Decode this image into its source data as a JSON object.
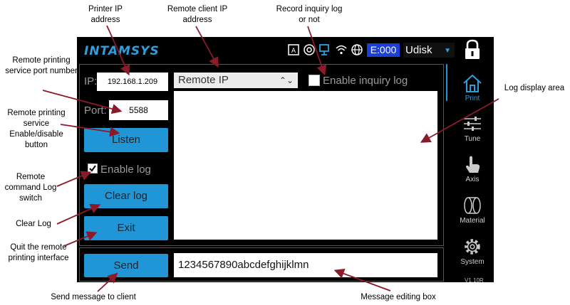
{
  "screen": {
    "logo": "INTAMSYS",
    "error_code": "E:000",
    "storage": "Udisk",
    "ip_label": "IP:",
    "ip_value": "192.168.1.209",
    "port_label": "Port:",
    "port_value": "5588",
    "listen_label": "Listen",
    "enable_log_label": "Enable log",
    "enable_log_checked": true,
    "clear_log_label": "Clear log",
    "exit_label": "Exit",
    "send_label": "Send",
    "remote_ip_select": "Remote IP",
    "enable_inquiry_label": "Enable inquiry log",
    "enable_inquiry_checked": false,
    "message": "1234567890abcdefghijklmn",
    "nav": [
      {
        "label": "Print",
        "icon": "home-icon",
        "active": true
      },
      {
        "label": "Tune",
        "icon": "sliders-icon",
        "active": false
      },
      {
        "label": "Axis",
        "icon": "hand-icon",
        "active": false
      },
      {
        "label": "Material",
        "icon": "filament-icon",
        "active": false
      },
      {
        "label": "System",
        "icon": "gear-icon",
        "active": false
      }
    ],
    "version": "V1.10R",
    "colors": {
      "accent": "#2196d6",
      "error_bg": "#1c3fd6",
      "screen_bg": "#000000"
    }
  },
  "annotations": {
    "printer_ip": "Printer IP address",
    "remote_client_ip": "Remote client IP address",
    "record_inquiry": "Record inquiry log or not",
    "port_number": "Remote printing service port number",
    "enable_disable": "Remote printing service Enable/disable button",
    "log_switch": "Remote command Log switch",
    "clear_log": "Clear Log",
    "quit": "Quit the remote printing interface",
    "send_msg": "Send message to client",
    "log_display": "Log display area",
    "msg_edit": "Message editing box"
  }
}
